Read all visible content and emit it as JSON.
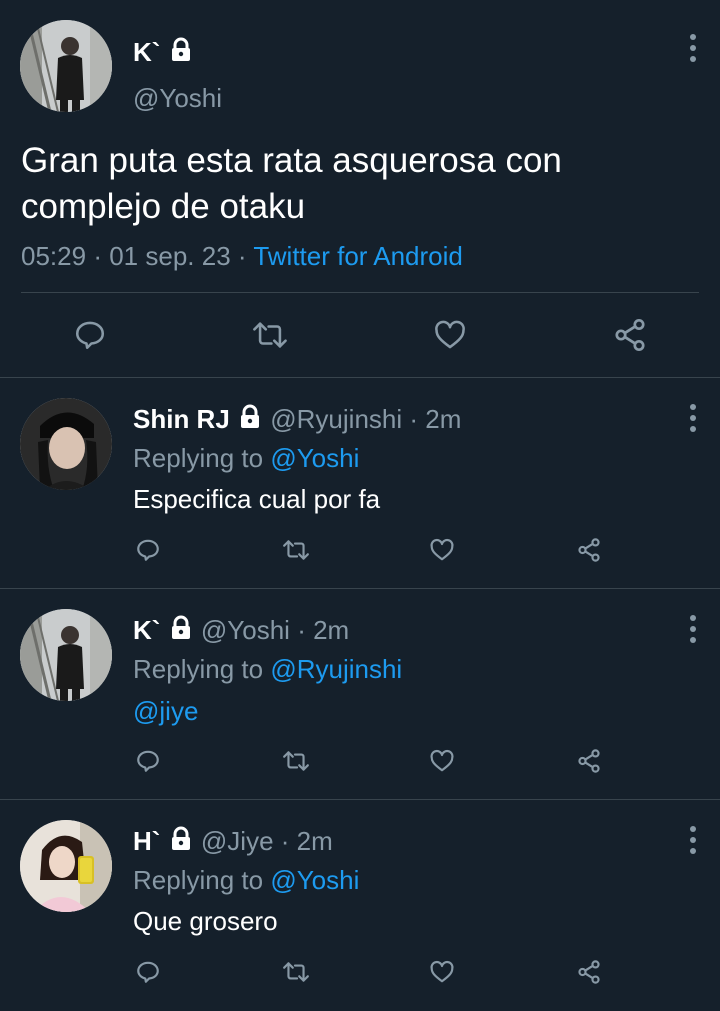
{
  "main_tweet": {
    "display_name": "K`",
    "handle": "@Yoshi",
    "text_line1": "Gran puta esta rata asquerosa con",
    "text_line2": "complejo de otaku",
    "time": "05:29",
    "date": "01 sep. 23",
    "separator": "·",
    "source": "Twitter for Android",
    "icons": [
      "reply-icon",
      "retweet-icon",
      "like-icon",
      "share-icon"
    ]
  },
  "replies": [
    {
      "display_name": "Shin RJ",
      "handle": "@Ryujinshi",
      "age": "· 2m",
      "replying_prefix": "Replying to",
      "replying_to": "@Yoshi",
      "text": "Especifica cual por fa"
    },
    {
      "display_name": "K`",
      "handle": "@Yoshi",
      "age": "· 2m",
      "replying_prefix": "Replying to",
      "replying_to": "@Ryujinshi",
      "text": "@jiye"
    },
    {
      "display_name": "H`",
      "handle": "@Jiye",
      "age": "· 2m",
      "replying_prefix": "Replying to",
      "replying_to": "@Yoshi",
      "text": "Que grosero"
    }
  ],
  "colors": {
    "background": "#15202b",
    "text": "#ffffff",
    "muted": "#8899a6",
    "link": "#1d9bf0",
    "divider": "#38444d"
  }
}
